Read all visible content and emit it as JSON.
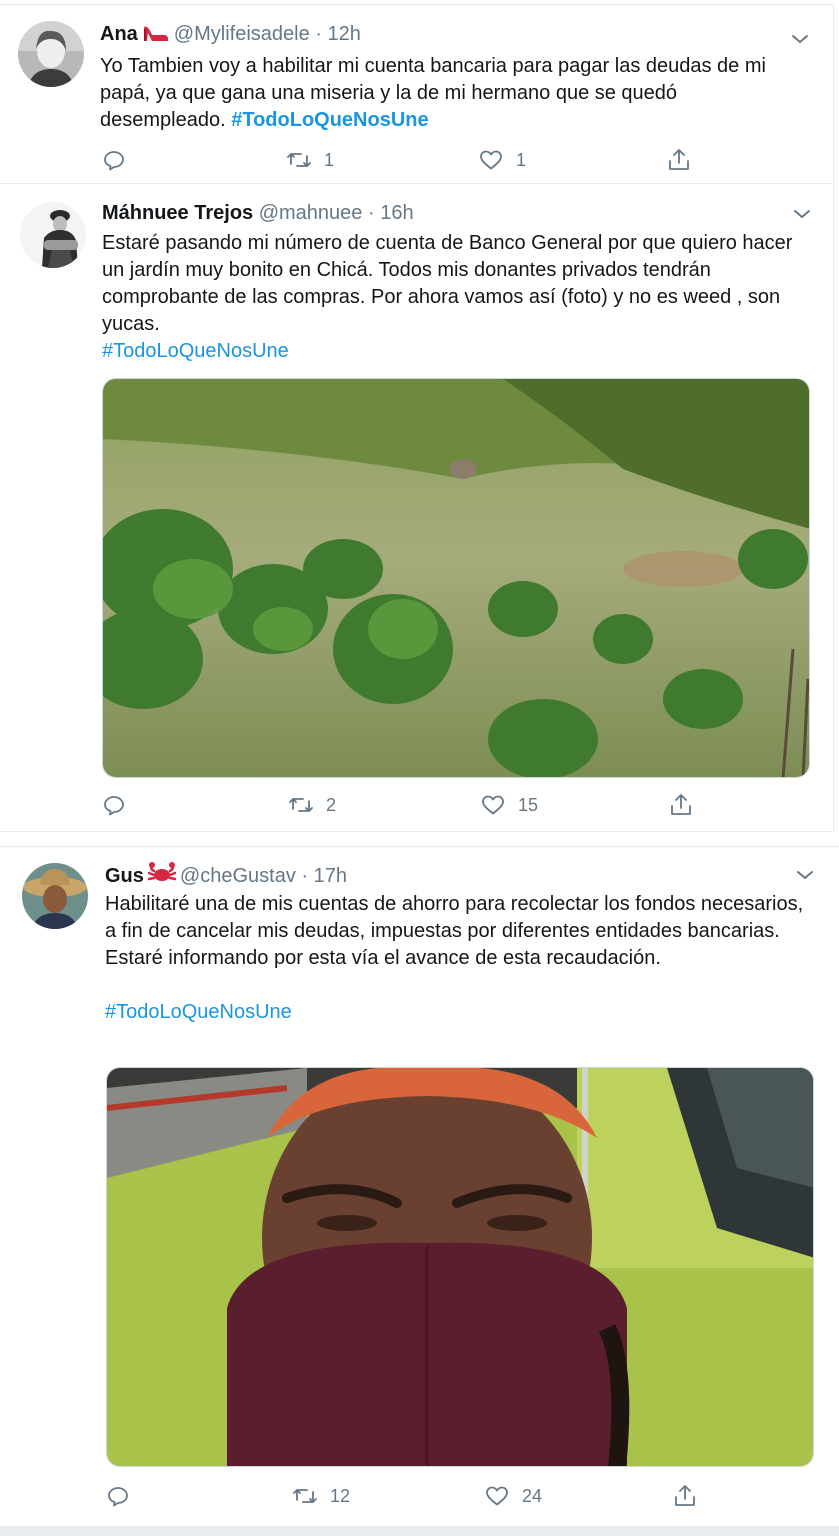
{
  "tweets": [
    {
      "name": "Ana",
      "name_emoji": "high-heel-icon",
      "handle": "@Mylifeisadele",
      "time": "12h",
      "text": "Yo Tambien voy a habilitar mi cuenta bancaria para pagar las deudas de mi papá, ya que gana una miseria y la de mi hermano que se quedó desempleado.",
      "hashtag": "#TodoLoQueNosUne",
      "replies": "",
      "retweets": "1",
      "likes": "1"
    },
    {
      "name": "Máhnuee Trejos",
      "handle": "@mahnuee",
      "time": "16h",
      "text": "Estaré pasando mi número de cuenta de Banco General por que quiero hacer un jardín muy bonito en Chicá. Todos mis donantes privados tendrán comprobante de las compras. Por ahora vamos así (foto) y no es weed , son yucas.",
      "hashtag": "#TodoLoQueNosUne",
      "media_icon": "yuca-garden-photo",
      "replies": "",
      "retweets": "2",
      "likes": "15"
    },
    {
      "name": "Gus",
      "name_emoji": "crab-icon",
      "handle": "@cheGustav",
      "time": "17h",
      "text_line1": "Habilitaré una de mis cuentas de ahorro para recolectar los fondos necesarios, a fin de cancelar mis deudas, impuestas por diferentes entidades bancarias.",
      "text_line2": "Estaré informando por esta vía el avance de esta recaudación.",
      "hashtag": "#TodoLoQueNosUne",
      "media_icon": "masked-selfie-photo",
      "replies": "",
      "retweets": "12",
      "likes": "24"
    }
  ],
  "separator": "·",
  "colors": {
    "link": "#1b95e0",
    "muted": "#657786",
    "border": "#e6ecf0"
  }
}
